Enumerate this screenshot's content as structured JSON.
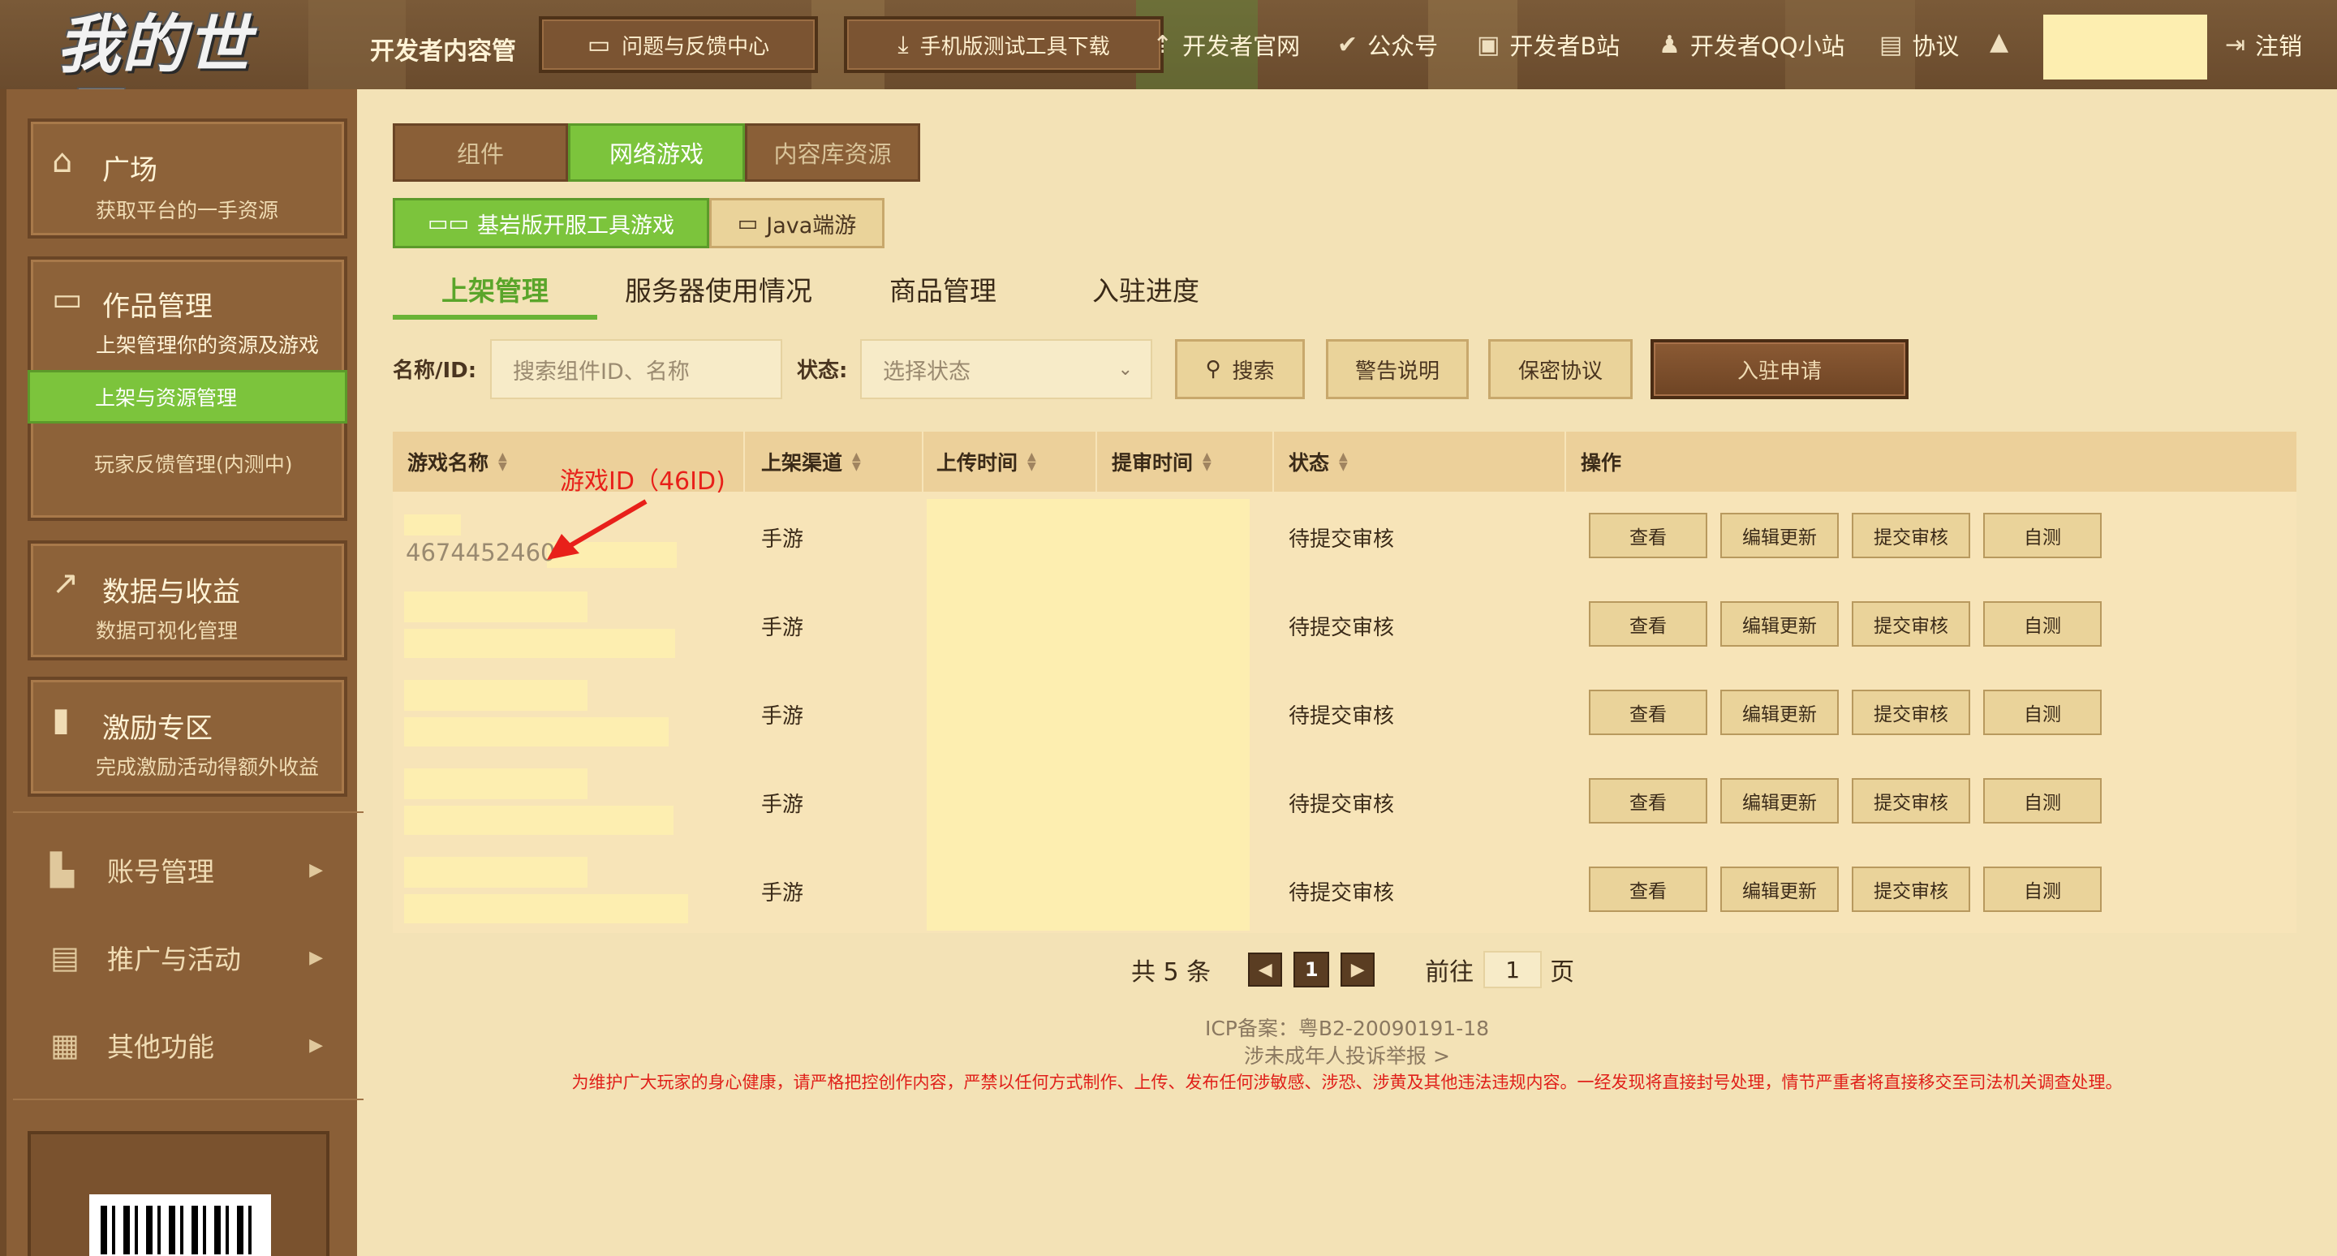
{
  "header": {
    "logo_text": "我的世界",
    "portal_title": "开发者内容管",
    "feedback_button": "问题与反馈中心",
    "download_button": "手机版测试工具下载",
    "links": [
      "开发者官网",
      "公众号",
      "开发者B站",
      "开发者QQ小站",
      "协议"
    ],
    "logout": "注销",
    "icons": {
      "feedback": "message-icon",
      "download": "download-icon",
      "official_site": "pin-icon",
      "wechat": "check-badge-icon",
      "bilibili": "tv-icon",
      "qq": "penguin-icon",
      "agreement": "document-icon",
      "notifications": "bell-icon",
      "logout": "logout-icon"
    }
  },
  "sidebar": {
    "plaza": {
      "title": "广场",
      "subtitle": "获取平台的一手资源",
      "icon": "home-icon"
    },
    "works": {
      "title": "作品管理",
      "subtitle": "上架管理你的资源及游戏",
      "icon": "folder-icon",
      "sub_items": [
        "上架与资源管理",
        "玩家反馈管理(内测中)"
      ]
    },
    "data": {
      "title": "数据与收益",
      "subtitle": "数据可视化管理",
      "icon": "chart-icon"
    },
    "incentive": {
      "title": "激励专区",
      "subtitle": "完成激励活动得额外收益",
      "icon": "bar-icon"
    },
    "menus": [
      {
        "label": "账号管理",
        "icon": "account-icon"
      },
      {
        "label": "推广与活动",
        "icon": "sign-icon"
      },
      {
        "label": "其他功能",
        "icon": "grid-icon"
      }
    ]
  },
  "tabs_primary": [
    "组件",
    "网络游戏",
    "内容库资源"
  ],
  "tabs_primary_active": 1,
  "tabs_secondary": [
    "基岩版开服工具游戏",
    "Java端游"
  ],
  "tabs_secondary_active": 0,
  "tabs_tertiary": [
    "上架管理",
    "服务器使用情况",
    "商品管理",
    "入驻进度"
  ],
  "tabs_tertiary_active": 0,
  "filters": {
    "name_label": "名称/ID:",
    "name_placeholder": "搜索组件ID、名称",
    "status_label": "状态:",
    "status_placeholder": "选择状态",
    "search_button": "搜索",
    "warning_button": "警告说明",
    "privacy_button": "保密协议",
    "apply_button": "入驻申请"
  },
  "table": {
    "columns": [
      "游戏名称",
      "上架渠道",
      "上传时间",
      "提审时间",
      "状态",
      "操作"
    ],
    "rows": [
      {
        "id": "4674452460",
        "channel": "手游",
        "status": "待提交审核"
      },
      {
        "id": "",
        "channel": "手游",
        "status": "待提交审核"
      },
      {
        "id": "",
        "channel": "手游",
        "status": "待提交审核"
      },
      {
        "id": "",
        "channel": "手游",
        "status": "待提交审核"
      },
      {
        "id": "",
        "channel": "手游",
        "status": "待提交审核"
      }
    ],
    "actions": [
      "查看",
      "编辑更新",
      "提交审核",
      "自测"
    ]
  },
  "annotation": "游戏ID（46ID)",
  "pagination": {
    "total_text": "共 5 条",
    "current_page": "1",
    "goto_label": "前往",
    "goto_value": "1",
    "page_suffix": "页"
  },
  "footer": {
    "icp": "ICP备案：粤B2-20090191-18",
    "report": "涉未成年人投诉举报 >",
    "warning": "为维护广大玩家的身心健康，请严格把控创作内容，严禁以任何方式制作、上传、发布任何涉敏感、涉恐、涉黄及其他违法违规内容。一经发现将直接封号处理，情节严重者将直接移交至司法机关调查处理。"
  }
}
